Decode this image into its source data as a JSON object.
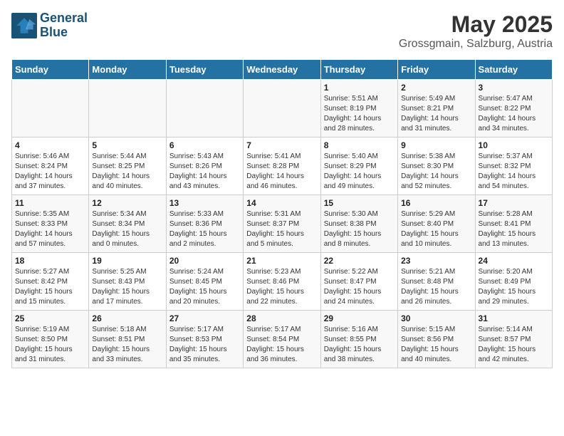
{
  "header": {
    "logo_line1": "General",
    "logo_line2": "Blue",
    "title": "May 2025",
    "subtitle": "Grossgmain, Salzburg, Austria"
  },
  "days_of_week": [
    "Sunday",
    "Monday",
    "Tuesday",
    "Wednesday",
    "Thursday",
    "Friday",
    "Saturday"
  ],
  "weeks": [
    [
      {
        "day": "",
        "info": ""
      },
      {
        "day": "",
        "info": ""
      },
      {
        "day": "",
        "info": ""
      },
      {
        "day": "",
        "info": ""
      },
      {
        "day": "1",
        "info": "Sunrise: 5:51 AM\nSunset: 8:19 PM\nDaylight: 14 hours\nand 28 minutes."
      },
      {
        "day": "2",
        "info": "Sunrise: 5:49 AM\nSunset: 8:21 PM\nDaylight: 14 hours\nand 31 minutes."
      },
      {
        "day": "3",
        "info": "Sunrise: 5:47 AM\nSunset: 8:22 PM\nDaylight: 14 hours\nand 34 minutes."
      }
    ],
    [
      {
        "day": "4",
        "info": "Sunrise: 5:46 AM\nSunset: 8:24 PM\nDaylight: 14 hours\nand 37 minutes."
      },
      {
        "day": "5",
        "info": "Sunrise: 5:44 AM\nSunset: 8:25 PM\nDaylight: 14 hours\nand 40 minutes."
      },
      {
        "day": "6",
        "info": "Sunrise: 5:43 AM\nSunset: 8:26 PM\nDaylight: 14 hours\nand 43 minutes."
      },
      {
        "day": "7",
        "info": "Sunrise: 5:41 AM\nSunset: 8:28 PM\nDaylight: 14 hours\nand 46 minutes."
      },
      {
        "day": "8",
        "info": "Sunrise: 5:40 AM\nSunset: 8:29 PM\nDaylight: 14 hours\nand 49 minutes."
      },
      {
        "day": "9",
        "info": "Sunrise: 5:38 AM\nSunset: 8:30 PM\nDaylight: 14 hours\nand 52 minutes."
      },
      {
        "day": "10",
        "info": "Sunrise: 5:37 AM\nSunset: 8:32 PM\nDaylight: 14 hours\nand 54 minutes."
      }
    ],
    [
      {
        "day": "11",
        "info": "Sunrise: 5:35 AM\nSunset: 8:33 PM\nDaylight: 14 hours\nand 57 minutes."
      },
      {
        "day": "12",
        "info": "Sunrise: 5:34 AM\nSunset: 8:34 PM\nDaylight: 15 hours\nand 0 minutes."
      },
      {
        "day": "13",
        "info": "Sunrise: 5:33 AM\nSunset: 8:36 PM\nDaylight: 15 hours\nand 2 minutes."
      },
      {
        "day": "14",
        "info": "Sunrise: 5:31 AM\nSunset: 8:37 PM\nDaylight: 15 hours\nand 5 minutes."
      },
      {
        "day": "15",
        "info": "Sunrise: 5:30 AM\nSunset: 8:38 PM\nDaylight: 15 hours\nand 8 minutes."
      },
      {
        "day": "16",
        "info": "Sunrise: 5:29 AM\nSunset: 8:40 PM\nDaylight: 15 hours\nand 10 minutes."
      },
      {
        "day": "17",
        "info": "Sunrise: 5:28 AM\nSunset: 8:41 PM\nDaylight: 15 hours\nand 13 minutes."
      }
    ],
    [
      {
        "day": "18",
        "info": "Sunrise: 5:27 AM\nSunset: 8:42 PM\nDaylight: 15 hours\nand 15 minutes."
      },
      {
        "day": "19",
        "info": "Sunrise: 5:25 AM\nSunset: 8:43 PM\nDaylight: 15 hours\nand 17 minutes."
      },
      {
        "day": "20",
        "info": "Sunrise: 5:24 AM\nSunset: 8:45 PM\nDaylight: 15 hours\nand 20 minutes."
      },
      {
        "day": "21",
        "info": "Sunrise: 5:23 AM\nSunset: 8:46 PM\nDaylight: 15 hours\nand 22 minutes."
      },
      {
        "day": "22",
        "info": "Sunrise: 5:22 AM\nSunset: 8:47 PM\nDaylight: 15 hours\nand 24 minutes."
      },
      {
        "day": "23",
        "info": "Sunrise: 5:21 AM\nSunset: 8:48 PM\nDaylight: 15 hours\nand 26 minutes."
      },
      {
        "day": "24",
        "info": "Sunrise: 5:20 AM\nSunset: 8:49 PM\nDaylight: 15 hours\nand 29 minutes."
      }
    ],
    [
      {
        "day": "25",
        "info": "Sunrise: 5:19 AM\nSunset: 8:50 PM\nDaylight: 15 hours\nand 31 minutes."
      },
      {
        "day": "26",
        "info": "Sunrise: 5:18 AM\nSunset: 8:51 PM\nDaylight: 15 hours\nand 33 minutes."
      },
      {
        "day": "27",
        "info": "Sunrise: 5:17 AM\nSunset: 8:53 PM\nDaylight: 15 hours\nand 35 minutes."
      },
      {
        "day": "28",
        "info": "Sunrise: 5:17 AM\nSunset: 8:54 PM\nDaylight: 15 hours\nand 36 minutes."
      },
      {
        "day": "29",
        "info": "Sunrise: 5:16 AM\nSunset: 8:55 PM\nDaylight: 15 hours\nand 38 minutes."
      },
      {
        "day": "30",
        "info": "Sunrise: 5:15 AM\nSunset: 8:56 PM\nDaylight: 15 hours\nand 40 minutes."
      },
      {
        "day": "31",
        "info": "Sunrise: 5:14 AM\nSunset: 8:57 PM\nDaylight: 15 hours\nand 42 minutes."
      }
    ]
  ]
}
